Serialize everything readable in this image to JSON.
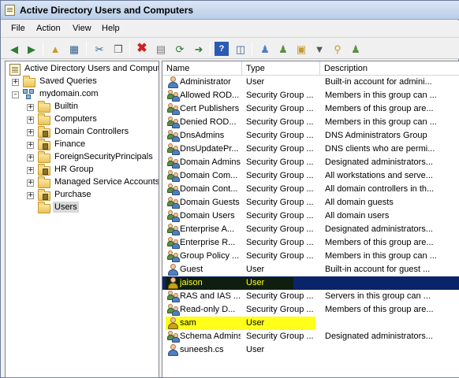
{
  "window": {
    "title": "Active Directory Users and Computers"
  },
  "menu": {
    "file": "File",
    "action": "Action",
    "view": "View",
    "help": "Help"
  },
  "toolbar": {
    "buttons": [
      "back-icon",
      "forward-icon",
      "up-folder-icon",
      "show-tree-icon",
      "cut-icon",
      "copy-icon",
      "delete-icon",
      "properties-icon",
      "refresh-icon",
      "export-icon",
      "help-icon",
      "mmc-view-icon",
      "new-user-icon",
      "new-group-icon",
      "new-ou-icon",
      "filter-icon",
      "find-icon",
      "add-to-group-icon"
    ]
  },
  "tree": {
    "root": "Active Directory Users and Comput",
    "saved_queries": "Saved Queries",
    "domain": "mydomain.com",
    "children": [
      "Builtin",
      "Computers",
      "Domain Controllers",
      "Finance",
      "ForeignSecurityPrincipals",
      "HR Group",
      "Managed Service Accounts",
      "Purchase",
      "Users"
    ],
    "selected": "Users"
  },
  "list": {
    "columns": {
      "name": "Name",
      "type": "Type",
      "description": "Description"
    },
    "rows": [
      {
        "name": "Administrator",
        "type": "User",
        "description": "Built-in account for admini...",
        "icon": "user-icon"
      },
      {
        "name": "Allowed ROD...",
        "type": "Security Group ...",
        "description": "Members in this group can ...",
        "icon": "group-icon"
      },
      {
        "name": "Cert Publishers",
        "type": "Security Group ...",
        "description": "Members of this group are...",
        "icon": "group-icon"
      },
      {
        "name": "Denied ROD...",
        "type": "Security Group ...",
        "description": "Members in this group can ...",
        "icon": "group-icon"
      },
      {
        "name": "DnsAdmins",
        "type": "Security Group ...",
        "description": "DNS Administrators Group",
        "icon": "group-icon"
      },
      {
        "name": "DnsUpdatePr...",
        "type": "Security Group ...",
        "description": "DNS clients who are permi...",
        "icon": "group-icon"
      },
      {
        "name": "Domain Admins",
        "type": "Security Group ...",
        "description": "Designated administrators...",
        "icon": "group-icon"
      },
      {
        "name": "Domain Com...",
        "type": "Security Group ...",
        "description": "All workstations and serve...",
        "icon": "group-icon"
      },
      {
        "name": "Domain Cont...",
        "type": "Security Group ...",
        "description": "All domain controllers in th...",
        "icon": "group-icon"
      },
      {
        "name": "Domain Guests",
        "type": "Security Group ...",
        "description": "All domain guests",
        "icon": "group-icon"
      },
      {
        "name": "Domain Users",
        "type": "Security Group ...",
        "description": "All domain users",
        "icon": "group-icon"
      },
      {
        "name": "Enterprise A...",
        "type": "Security Group ...",
        "description": "Designated administrators...",
        "icon": "group-icon"
      },
      {
        "name": "Enterprise R...",
        "type": "Security Group ...",
        "description": "Members of this group are...",
        "icon": "group-icon"
      },
      {
        "name": "Group Policy ...",
        "type": "Security Group ...",
        "description": "Members in this group can ...",
        "icon": "group-icon"
      },
      {
        "name": "Guest",
        "type": "User",
        "description": "Built-in account for guest ...",
        "icon": "user-icon"
      },
      {
        "name": "jaison",
        "type": "User",
        "description": "",
        "icon": "user-icon"
      },
      {
        "name": "RAS and IAS ...",
        "type": "Security Group ...",
        "description": "Servers in this group can ...",
        "icon": "group-icon"
      },
      {
        "name": "Read-only D...",
        "type": "Security Group ...",
        "description": "Members of this group are...",
        "icon": "group-icon"
      },
      {
        "name": "sam",
        "type": "User",
        "description": "",
        "icon": "user-icon"
      },
      {
        "name": "Schema Admins",
        "type": "Security Group ...",
        "description": "Designated administrators...",
        "icon": "group-icon"
      },
      {
        "name": "suneesh.cs",
        "type": "User",
        "description": "",
        "icon": "user-icon"
      }
    ]
  },
  "colors": {
    "selection": "#0a246a",
    "marker": "#ffff1a"
  }
}
